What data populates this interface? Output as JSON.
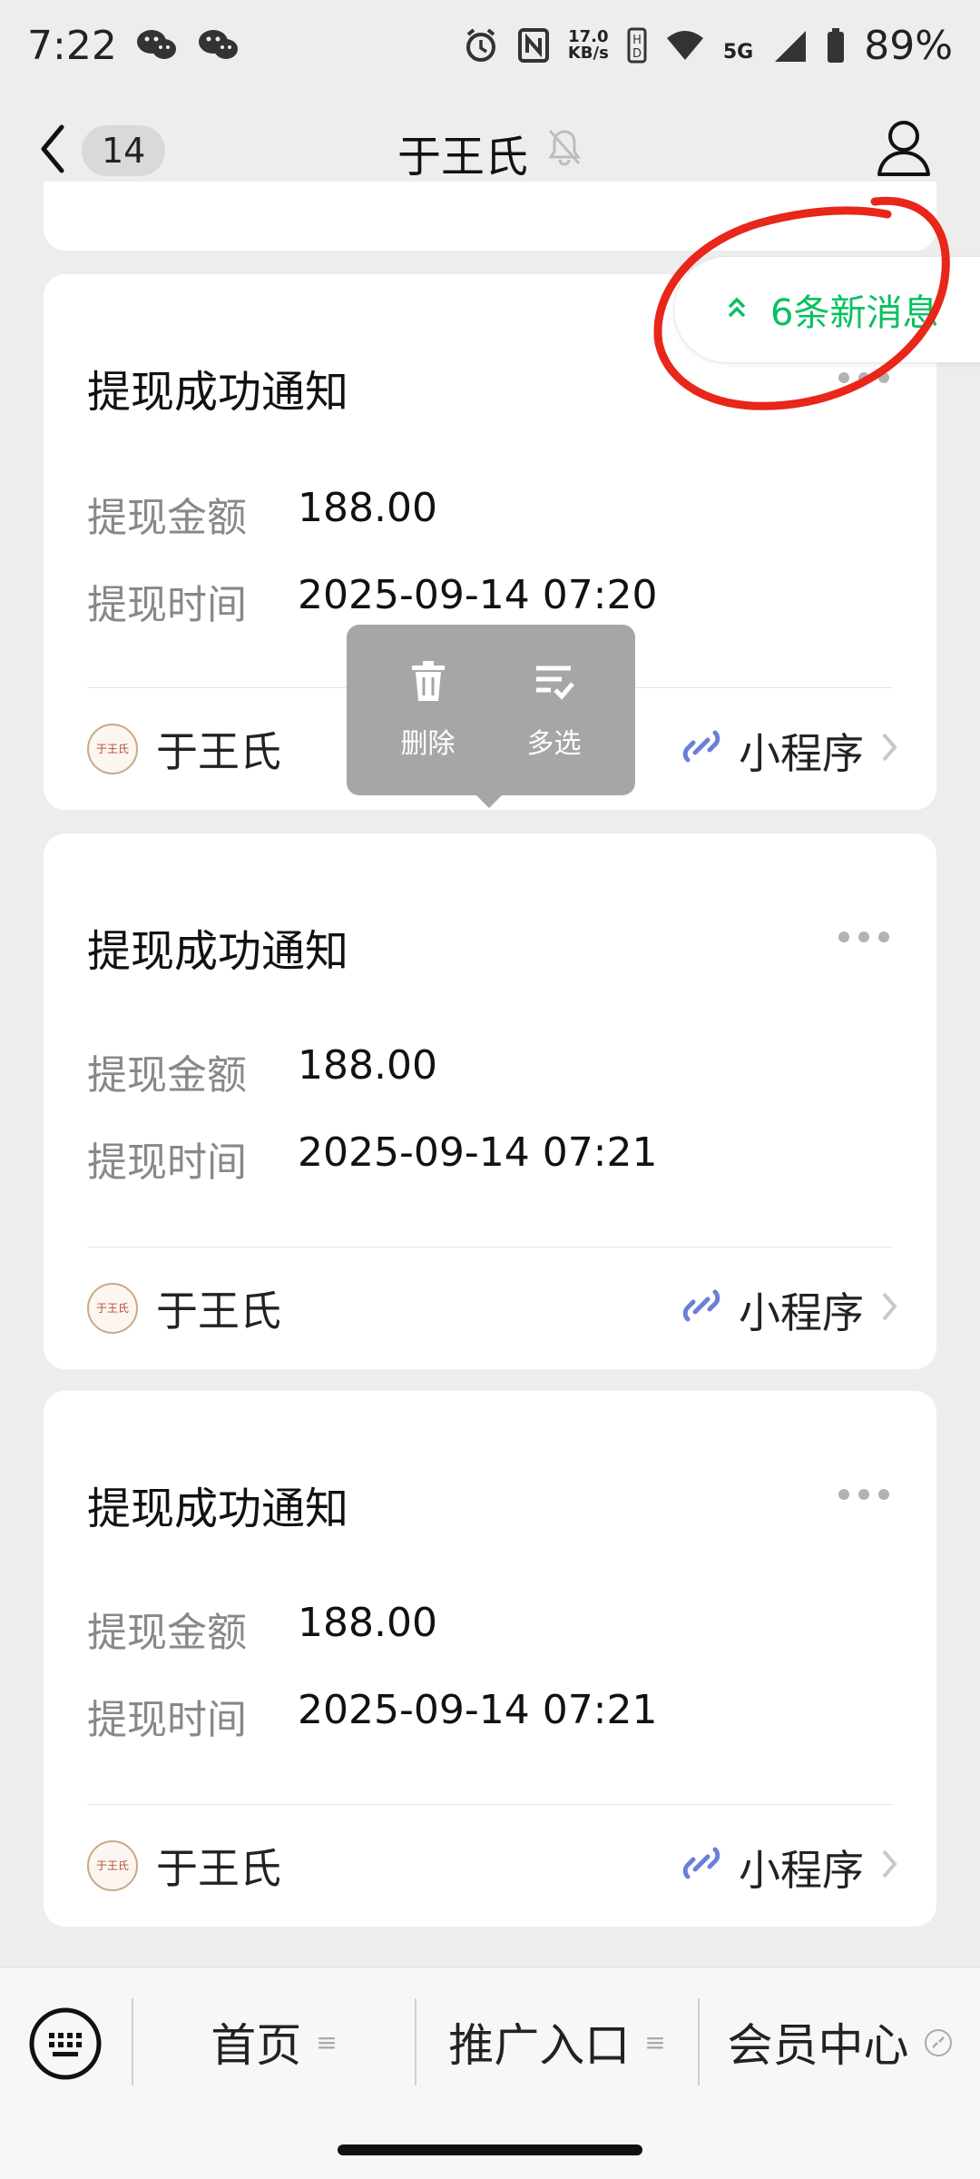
{
  "status_bar": {
    "time": "7:22",
    "net_speed_value": "17.0",
    "net_speed_unit": "KB/s",
    "network": "5G",
    "battery": "89%"
  },
  "nav": {
    "unread_count": "14",
    "title": "于王氏"
  },
  "new_messages": {
    "label": "6条新消息",
    "color": "#07c160"
  },
  "context_menu": {
    "delete_label": "删除",
    "multi_select_label": "多选"
  },
  "cards": [
    {
      "title": "提现成功通知",
      "amount_label": "提现金额",
      "amount_value": "188.00",
      "time_label": "提现时间",
      "time_value": "2025-09-14 07:20",
      "source_name": "于王氏",
      "mini_program_label": "小程序"
    },
    {
      "title": "提现成功通知",
      "amount_label": "提现金额",
      "amount_value": "188.00",
      "time_label": "提现时间",
      "time_value": "2025-09-14 07:21",
      "source_name": "于王氏",
      "mini_program_label": "小程序"
    },
    {
      "title": "提现成功通知",
      "amount_label": "提现金额",
      "amount_value": "188.00",
      "time_label": "提现时间",
      "time_value": "2025-09-14 07:21",
      "source_name": "于王氏",
      "mini_program_label": "小程序"
    }
  ],
  "avatar_text": "于王氏",
  "bottom_menu": {
    "items": [
      {
        "label": "首页"
      },
      {
        "label": "推广入口"
      },
      {
        "label": "会员中心"
      }
    ]
  },
  "annotation_color": "#e8261a"
}
